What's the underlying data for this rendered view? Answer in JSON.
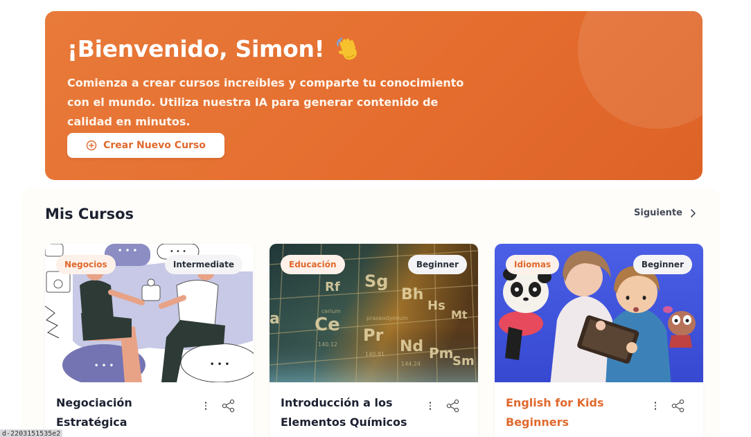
{
  "hero": {
    "title": "¡Bienvenido, Simon!",
    "wave_icon": "waving-hand-emoji",
    "description": "Comienza a crear cursos increíbles y comparte tu conocimiento con el mundo. Utiliza nuestra IA para generar contenido de calidad en minutos.",
    "cta_label": "Crear Nuevo Curso",
    "cta_icon": "plus-circle-icon",
    "colors": {
      "gradient_start": "#e87a3a",
      "gradient_end": "#dd6226",
      "accent": "#e0692d"
    }
  },
  "courses_section": {
    "title": "Mis Cursos",
    "next_label": "Siguiente",
    "next_icon": "chevron-right-icon"
  },
  "courses": [
    {
      "category": "Negocios",
      "level": "Intermediate",
      "title": "Negociación Estratégica Intermedia",
      "image": "negotiation-illustration",
      "title_color": "#1c2130"
    },
    {
      "category": "Educación",
      "level": "Beginner",
      "title": "Introducción a los Elementos Químicos",
      "image": "periodic-table-photo",
      "title_color": "#1c2130"
    },
    {
      "category": "Idiomas",
      "level": "Beginner",
      "title": "English for Kids Beginners",
      "image": "kids-with-tablet-photo",
      "title_color": "#e0692d"
    }
  ],
  "debug_badge": "d-2203151535e2"
}
